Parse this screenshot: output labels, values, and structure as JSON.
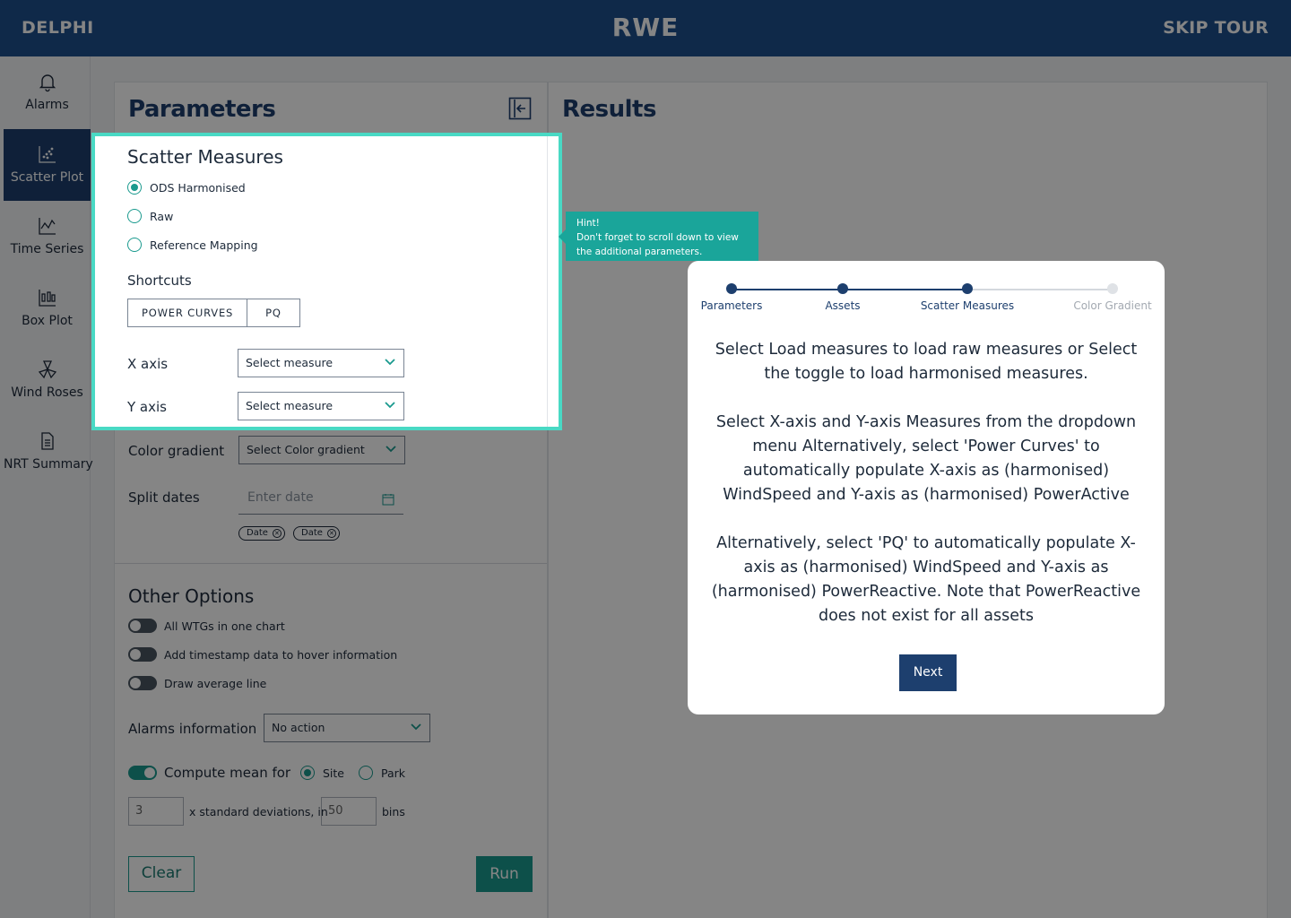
{
  "topbar": {
    "app_name": "DELPHI",
    "brand": "RWE",
    "skip_label": "SKIP TOUR"
  },
  "sidebar": {
    "items": [
      {
        "label": "Alarms",
        "icon": "bell-icon"
      },
      {
        "label": "Scatter Plot",
        "icon": "scatter-icon",
        "active": true
      },
      {
        "label": "Time Series",
        "icon": "line-chart-icon"
      },
      {
        "label": "Box Plot",
        "icon": "box-plot-icon"
      },
      {
        "label": "Wind Roses",
        "icon": "wind-rose-icon"
      },
      {
        "label": "NRT Summary",
        "icon": "document-icon"
      }
    ]
  },
  "parameters": {
    "title": "Parameters",
    "scatter_measures": {
      "title": "Scatter Measures",
      "options": [
        "ODS Harmonised",
        "Raw",
        "Reference Mapping"
      ],
      "selected": "ODS Harmonised"
    },
    "shortcuts": {
      "label": "Shortcuts",
      "buttons": [
        "POWER CURVES",
        "PQ"
      ]
    },
    "x_axis": {
      "label": "X axis",
      "value": "Select measure"
    },
    "y_axis": {
      "label": "Y axis",
      "value": "Select measure"
    },
    "color_gradient": {
      "label": "Color gradient",
      "value": "Select Color gradient"
    },
    "split_dates": {
      "label": "Split dates",
      "placeholder": "Enter date",
      "chips": [
        "Date",
        "Date"
      ]
    },
    "other_options": {
      "title": "Other Options",
      "toggles": [
        {
          "label": "All WTGs in one chart",
          "on": false
        },
        {
          "label": "Add timestamp data to hover information",
          "on": false
        },
        {
          "label": "Draw average line",
          "on": false
        }
      ],
      "alarms": {
        "label": "Alarms information",
        "value": "No action"
      },
      "compute_mean": {
        "label": "Compute mean for",
        "on": true,
        "options": [
          "Site",
          "Park"
        ],
        "selected": "Site"
      },
      "std_dev": {
        "value": "3",
        "text": "x standard deviations, in",
        "bins_value": "50",
        "bins_text": "bins"
      }
    },
    "clear_label": "Clear",
    "run_label": "Run"
  },
  "results": {
    "title": "Results"
  },
  "hint": {
    "title": "Hint!",
    "text": "Don't forget to scroll down to view the additional parameters."
  },
  "tour": {
    "steps": [
      "Parameters",
      "Assets",
      "Scatter Measures",
      "Color Gradient"
    ],
    "current_step": 3,
    "paragraphs": [
      "Select Load measures to load raw measures or Select the toggle to load harmonised measures.",
      "Select X-axis and Y-axis Measures from the dropdown menu Alternatively, select 'Power Curves' to automatically populate X-axis as (harmonised) WindSpeed and Y-axis as (harmonised) PowerActive",
      "Alternatively, select 'PQ' to automatically populate X-axis as (harmonised) WindSpeed and Y-axis as (harmonised) PowerReactive. Note that PowerReactive does not exist for all assets"
    ],
    "next_label": "Next"
  },
  "colors": {
    "primary": "#1d4f8c",
    "navy": "#1d3f6e",
    "teal": "#1a9a8e",
    "highlight": "#49d9c4"
  }
}
